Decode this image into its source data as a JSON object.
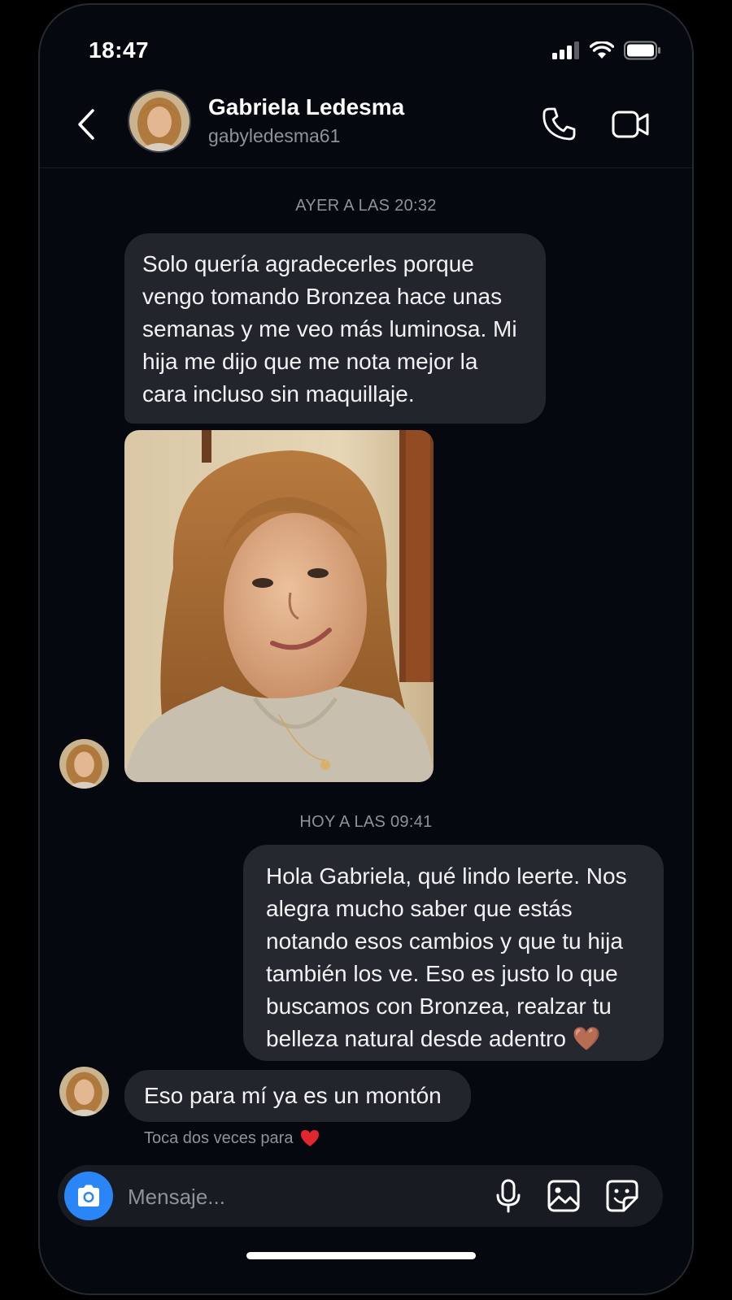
{
  "status_bar": {
    "time": "18:47"
  },
  "header": {
    "name": "Gabriela Ledesma",
    "handle": "gabyledesma61"
  },
  "conversation": {
    "timestamp_1": "AYER A LAS 20:32",
    "received_message_1": "Solo quería agradecerles porque vengo tomando Bronzea hace unas semanas y me veo más luminosa. Mi hija me dijo que me nota mejor la cara incluso sin maquillaje.",
    "timestamp_2": "HOY A LAS 09:41",
    "sent_message_1": "Hola Gabriela, qué lindo leerte. Nos alegra mucho saber que estás notando esos cambios y que tu hija también los ve. Eso es justo lo que buscamos con Bronzea, realzar tu belleza natural desde adentro 🤎",
    "received_message_2": "Eso para mí ya es un montón",
    "double_tap_hint": "Toca dos veces para",
    "hint_emoji": "❤️"
  },
  "composer": {
    "placeholder": "Mensaje..."
  },
  "colors": {
    "background": "#05080f",
    "bubble": "#22252b",
    "secondary_text": "#8e9299",
    "accent_blue": "#2a86f7",
    "heart_red": "#e0262f",
    "brown_heart": "#7a4a2a"
  },
  "icons": {
    "back": "chevron-left-icon",
    "call": "phone-icon",
    "video": "video-camera-icon",
    "camera": "camera-icon",
    "mic": "microphone-icon",
    "gallery": "image-icon",
    "sticker": "sticker-icon"
  }
}
